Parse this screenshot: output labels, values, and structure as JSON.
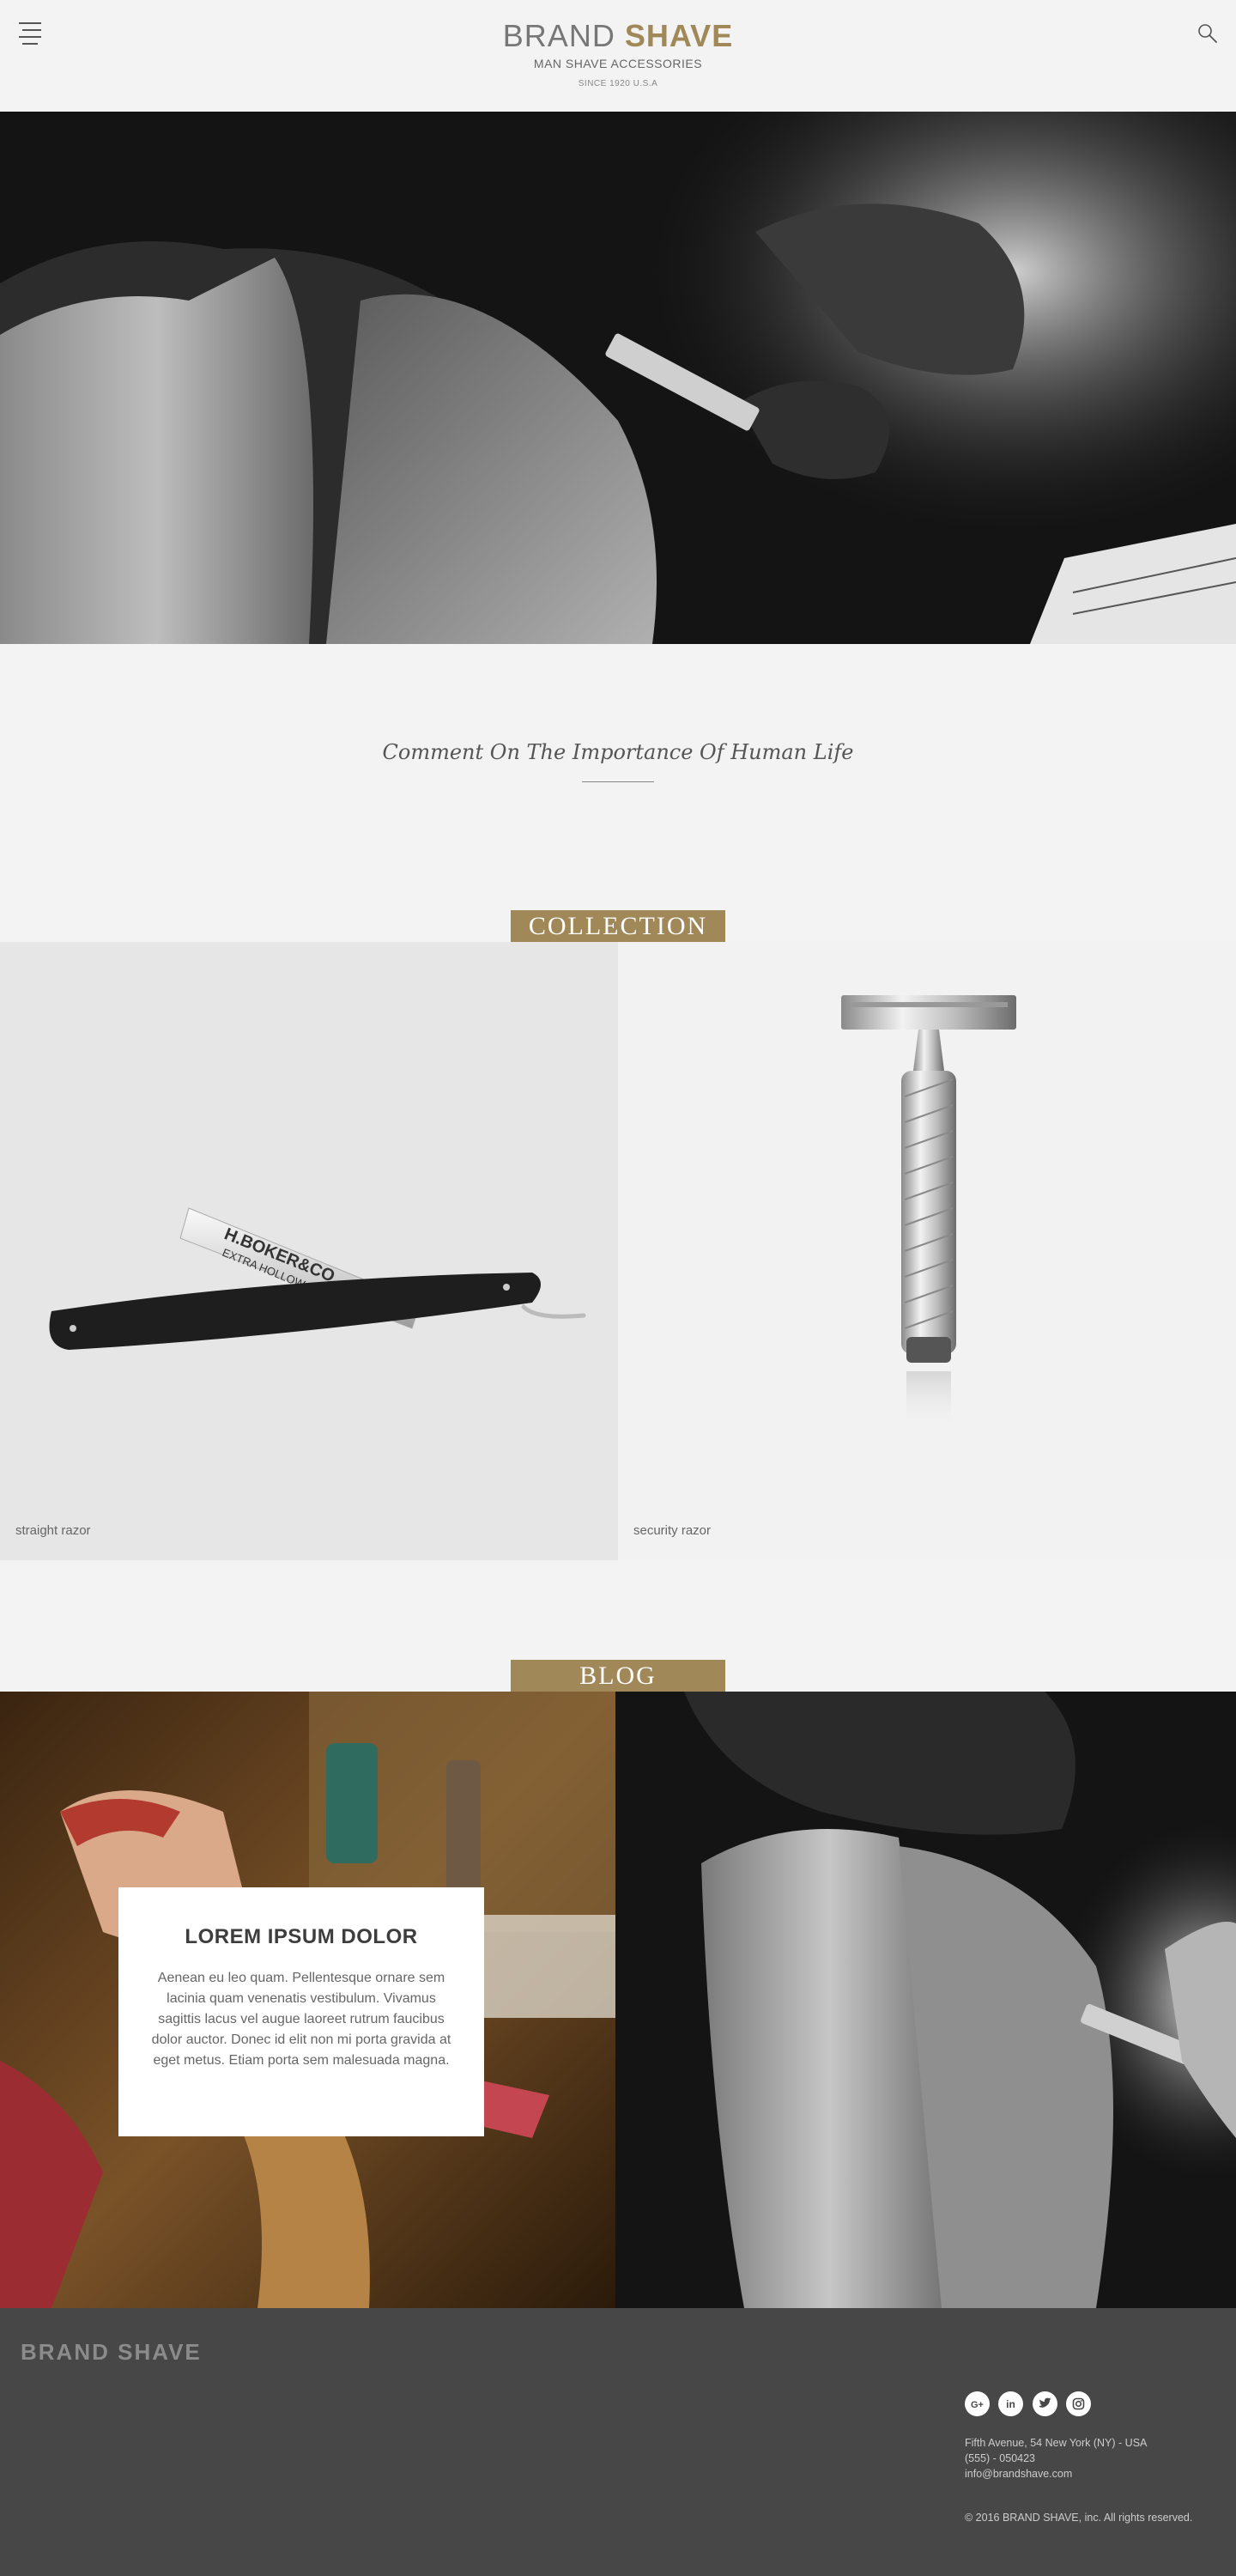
{
  "header": {
    "brand_light": "BRAND",
    "brand_bold": "SHAVE",
    "subtitle": "MAN SHAVE ACCESSORIES",
    "since": "SINCE 1920 U.S.A"
  },
  "intro": {
    "quote": "Comment On The Importance Of Human Life"
  },
  "collection": {
    "label": "COLLECTION",
    "items": [
      {
        "caption": "straight razor",
        "engraving": "H.BOKER&CO",
        "engraving_sub": "EXTRA HOLLOW GROUND"
      },
      {
        "caption": "security razor"
      }
    ]
  },
  "blog": {
    "label": "BLOG",
    "post": {
      "title": "LOREM IPSUM DOLOR",
      "body": "Aenean eu leo quam. Pellentesque ornare sem lacinia quam venenatis vestibulum. Vivamus sagittis lacus vel augue laoreet rutrum faucibus dolor auctor. Donec id elit non mi porta gravida at eget metus. Etiam porta sem malesuada magna."
    }
  },
  "footer": {
    "brand": "BRAND SHAVE",
    "address": "Fifth Avenue, 54 New York (NY) - USA",
    "phone": "(555) - 050423",
    "email": "info@brandshave.com",
    "copyright": "© 2016 BRAND SHAVE, inc. All rights reserved.",
    "socials": [
      "google-plus-icon",
      "linkedin-icon",
      "twitter-icon",
      "instagram-icon"
    ]
  },
  "colors": {
    "accent": "#a08858",
    "background": "#f3f3f3",
    "footer": "#474747"
  }
}
